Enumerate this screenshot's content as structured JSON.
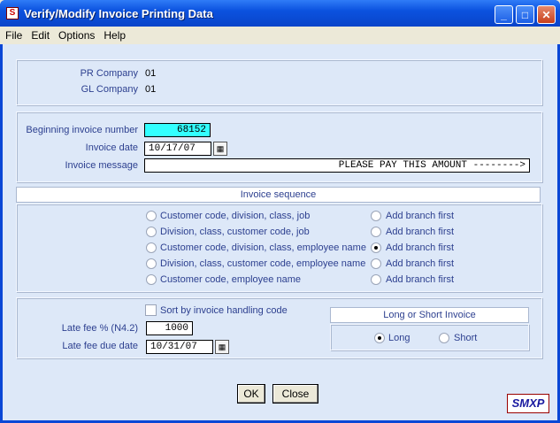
{
  "window": {
    "title": "Verify/Modify Invoice Printing Data",
    "app_icon": "S",
    "controls": {
      "minimize": "_",
      "maximize": "□",
      "close": "✕"
    }
  },
  "menu": [
    "File",
    "Edit",
    "Options",
    "Help"
  ],
  "company": {
    "pr_label": "PR Company",
    "pr_value": "01",
    "gl_label": "GL Company",
    "gl_value": "01"
  },
  "invoice": {
    "beginning_label": "Beginning invoice number",
    "beginning_value": "68152",
    "date_label": "Invoice date",
    "date_value": "10/17/07",
    "message_label": "Invoice message",
    "message_value": "PLEASE PAY THIS AMOUNT -------->"
  },
  "sequence": {
    "header": "Invoice sequence",
    "options": [
      {
        "label": "Customer code, division, class, job",
        "branch": "Add branch first",
        "selected": false,
        "branch_selected": false
      },
      {
        "label": "Division, class, customer code, job",
        "branch": "Add branch first",
        "selected": false,
        "branch_selected": false
      },
      {
        "label": "Customer code, division, class, employee name",
        "branch": "Add branch first",
        "selected": false,
        "branch_selected": true
      },
      {
        "label": "Division, class, customer code, employee name",
        "branch": "Add branch first",
        "selected": false,
        "branch_selected": false
      },
      {
        "label": "Customer code, employee name",
        "branch": "Add branch first",
        "selected": false,
        "branch_selected": false
      }
    ]
  },
  "fees": {
    "sort_label": "Sort by invoice handling code",
    "sort_checked": false,
    "late_fee_label": "Late fee % (N4.2)",
    "late_fee_value": "1000",
    "due_date_label": "Late fee due date",
    "due_date_value": "10/31/07"
  },
  "invoice_type": {
    "header": "Long or Short Invoice",
    "long_label": "Long",
    "short_label": "Short",
    "selected": "Long"
  },
  "buttons": {
    "ok": "OK",
    "close": "Close"
  },
  "logo_text": "SMXP",
  "colors": {
    "title_bar": "#0b52df",
    "client_bg": "#dde8f8",
    "label": "#2c3f8f",
    "highlight_field": "#33ffff"
  }
}
